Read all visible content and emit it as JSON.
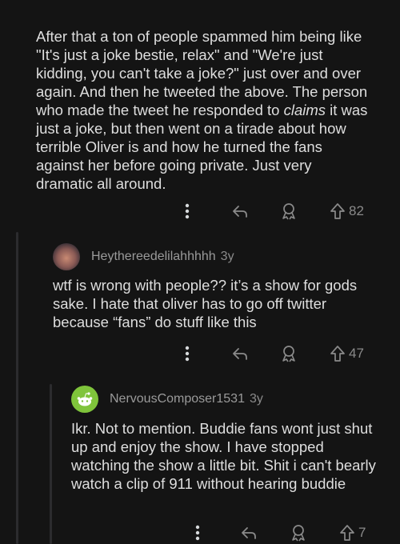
{
  "comments": [
    {
      "body_parts": {
        "before": "After that a ton of people spammed him being like \"It's just a joke bestie, relax\" and \"We're just kidding, you can't take a joke?\" just over and over again. And then he tweeted the above. The person who made the tweet he responded to ",
        "emph": "claims",
        "after": " it was just a joke, but then went on a tirade about how terrible Oliver is and how he turned the fans against her before going private. Just very dramatic all around."
      },
      "upvotes": "82"
    },
    {
      "author": "Heythereedelilahhhhh",
      "age": "3y",
      "body": "wtf is wrong with people??  it’s a show for gods sake. I hate that oliver has to go off twitter because “fans” do stuff like this",
      "upvotes": "47"
    },
    {
      "author": "NervousComposer1531",
      "age": "3y",
      "body": "Ikr. Not to mention.  Buddie fans wont just shut up and enjoy the show. I have stopped watching the show a little bit. Shit i can't bearly watch a clip of 911 without hearing buddie",
      "upvotes": "7"
    }
  ],
  "icons": [
    "more-options-icon",
    "reply-icon",
    "award-icon",
    "upvote-icon"
  ],
  "colors": {
    "background": "#141414",
    "text": "#dedede",
    "muted": "#8a8a8a",
    "thread_line": "#2c2c2e",
    "avatar_green": "#7fc43b"
  }
}
